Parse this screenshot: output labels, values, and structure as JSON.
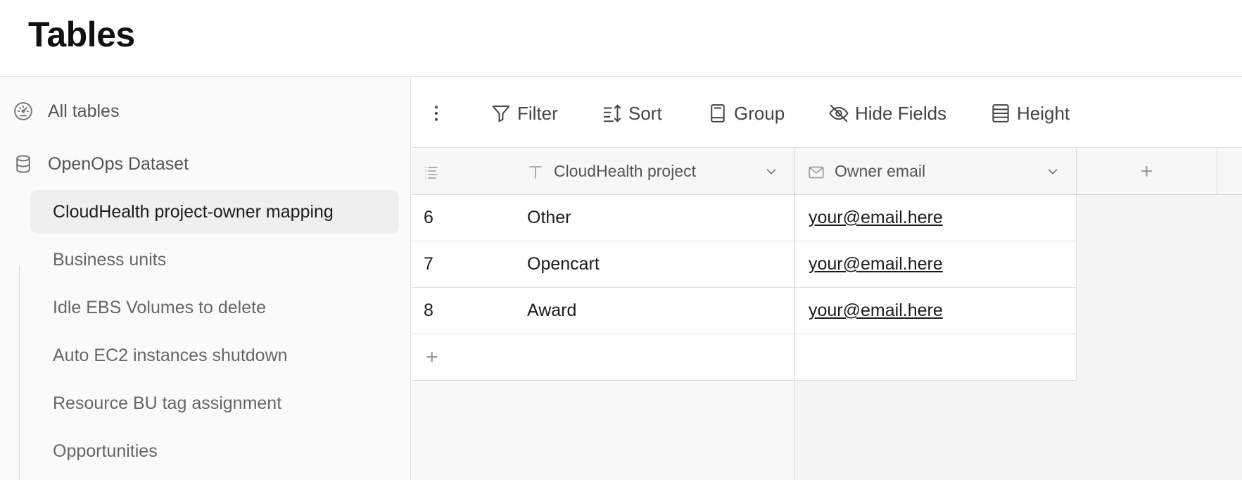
{
  "page": {
    "title": "Tables"
  },
  "sidebar": {
    "all_tables": "All tables",
    "dataset": "OpenOps Dataset",
    "tables": [
      {
        "label": "CloudHealth project-owner mapping",
        "active": true
      },
      {
        "label": "Business units"
      },
      {
        "label": "Idle EBS Volumes to delete"
      },
      {
        "label": "Auto EC2 instances shutdown"
      },
      {
        "label": "Resource BU tag assignment"
      },
      {
        "label": "Opportunities"
      }
    ]
  },
  "toolbar": {
    "filter": "Filter",
    "sort": "Sort",
    "group": "Group",
    "hide_fields": "Hide Fields",
    "height": "Height"
  },
  "grid": {
    "columns": [
      {
        "label": "CloudHealth project",
        "icon": "text-type-icon"
      },
      {
        "label": "Owner email",
        "icon": "email-icon"
      }
    ],
    "rows": [
      {
        "id": "6",
        "project": "Other",
        "email": "your@email.here"
      },
      {
        "id": "7",
        "project": "Opencart",
        "email": "your@email.here"
      },
      {
        "id": "8",
        "project": "Award",
        "email": "your@email.here"
      }
    ]
  }
}
